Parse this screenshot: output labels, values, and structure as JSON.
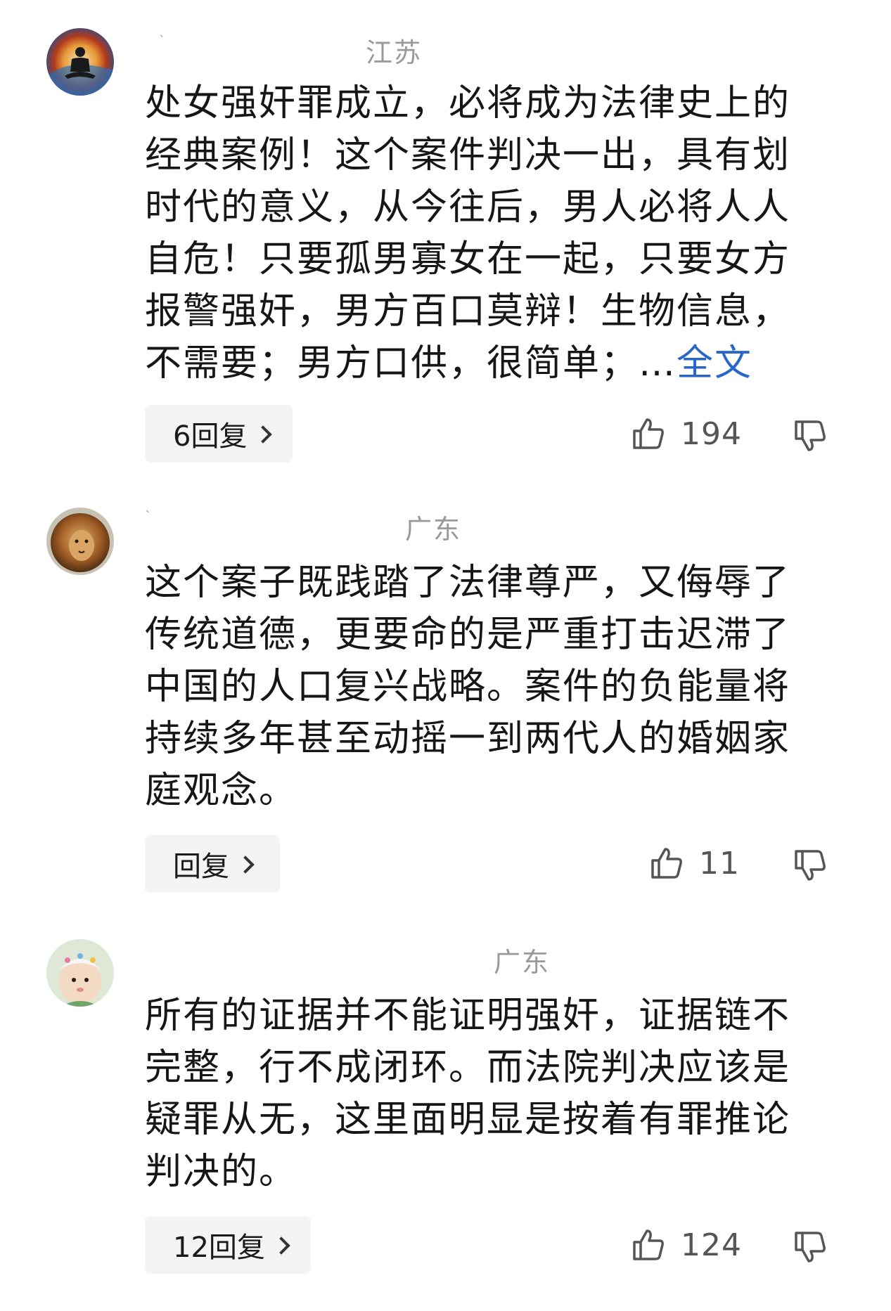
{
  "comments": [
    {
      "username_hint": "`",
      "location": "江苏",
      "text": "处女强奸罪成立，必将成为法律史上的经典案例！这个案件判决一出，具有划时代的意义，从今往后，男人必将人人自危！只要孤男寡女在一起，只要女方报警强奸，男方百口莫辩！生物信息，不需要；男方口供，很简单；…",
      "more_label": "全文",
      "reply_label": "6回复",
      "likes": "194",
      "avatar_icon": "meditation-figure-avatar"
    },
    {
      "username_hint": "`",
      "location": "广东",
      "text": "这个案子既践踏了法律尊严，又侮辱了传统道德，更要命的是严重打击迟滞了中国的人口复兴战略。案件的负能量将持续多年甚至动摇一到两代人的婚姻家庭观念。",
      "reply_label": "回复",
      "likes": "11",
      "avatar_icon": "lion-avatar"
    },
    {
      "location": "广东",
      "text": "所有的证据并不能证明强奸，证据链不完整，行不成闭环。而法院判决应该是疑罪从无，这里面明显是按着有罪推论判决的。",
      "reply_label": "12回复",
      "likes": "124",
      "avatar_icon": "baby-avatar"
    }
  ],
  "icons": {
    "like": "thumbs-up-icon",
    "dislike": "thumbs-down-icon",
    "chevron": "chevron-right-icon"
  },
  "colors": {
    "location": "#9a9a9a",
    "link": "#2a66c9",
    "reply_bg": "#f4f4f4"
  }
}
